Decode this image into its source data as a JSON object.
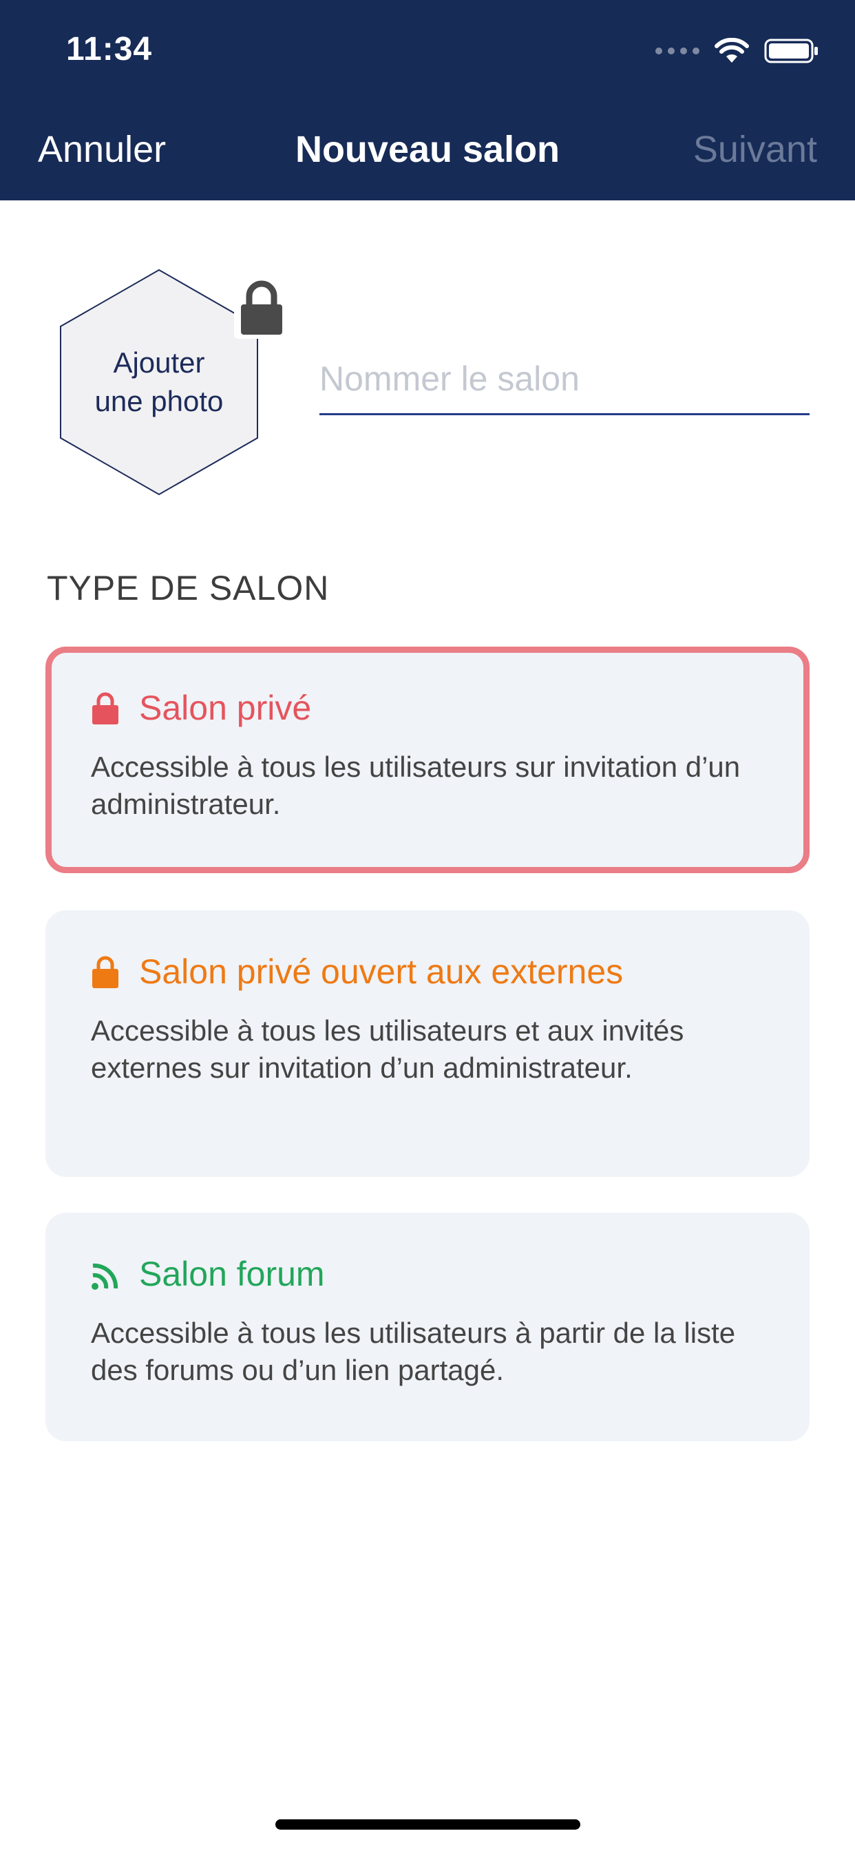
{
  "status_bar": {
    "time": "11:34",
    "icons": [
      "signal-dots-icon",
      "wifi-icon",
      "battery-icon"
    ]
  },
  "nav": {
    "cancel_label": "Annuler",
    "title": "Nouveau salon",
    "next_label": "Suivant"
  },
  "photo": {
    "label": "Ajouter\nune photo",
    "badge_icon": "lock-icon"
  },
  "room_name": {
    "value": "",
    "placeholder": "Nommer le salon"
  },
  "section_title": "TYPE DE SALON",
  "room_types": [
    {
      "title": "Salon privé",
      "description": "Accessible à tous les utilisateurs sur invitation d’un administrateur.",
      "icon": "lock-icon",
      "color": "#e5545d",
      "selected": true
    },
    {
      "title": "Salon privé ouvert aux externes",
      "description": "Accessible à tous les utilisateurs et aux invités externes sur invitation d’un administrateur.",
      "icon": "lock-icon",
      "color": "#ee7a14",
      "selected": false
    },
    {
      "title": "Salon forum",
      "description": "Accessible à tous les utilisateurs à partir de la liste des forums ou d’un lien partagé.",
      "icon": "rss-icon",
      "color": "#22a65a",
      "selected": false
    }
  ],
  "colors": {
    "header_bg": "#172b57",
    "accent": "#243a8a",
    "selected_border": "#ea7d86",
    "card_bg": "#f0f3f7"
  }
}
